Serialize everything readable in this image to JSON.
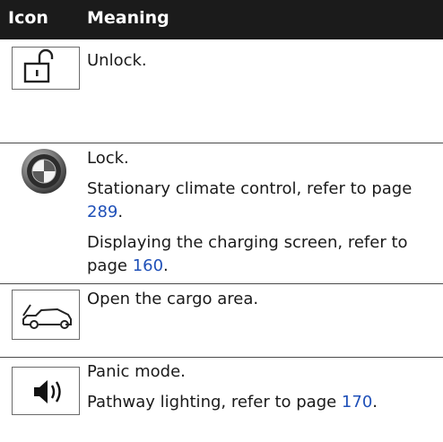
{
  "header": {
    "icon_label": "Icon",
    "meaning_label": "Meaning"
  },
  "rows": [
    {
      "icon": "unlock-icon",
      "lines": [
        {
          "text": "Unlock."
        }
      ]
    },
    {
      "icon": "bmw-logo-icon",
      "lines": [
        {
          "text": "Lock."
        },
        {
          "text": "Stationary climate control, refer to page ",
          "page": "289",
          "end": "."
        },
        {
          "text": "Displaying the charging screen, refer to page ",
          "page": "160",
          "end": "."
        }
      ]
    },
    {
      "icon": "car-trunk-icon",
      "lines": [
        {
          "text": "Open the cargo area."
        }
      ]
    },
    {
      "icon": "panic-horn-icon",
      "lines": [
        {
          "text": "Panic mode."
        },
        {
          "text": "Pathway lighting, refer to page ",
          "page": "170",
          "end": "."
        }
      ]
    }
  ],
  "colors": {
    "header_bg": "#1b1b1b",
    "link": "#1f50b8"
  }
}
